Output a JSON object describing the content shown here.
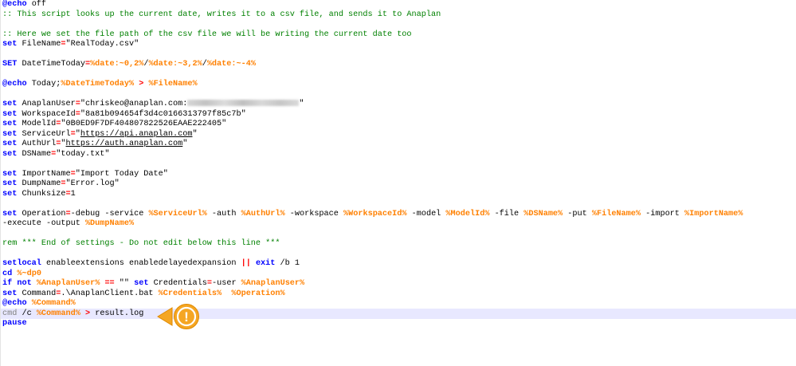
{
  "lines": [
    {
      "parts": [
        [
          "kw",
          "@echo"
        ],
        [
          "txt",
          " off"
        ]
      ]
    },
    {
      "parts": [
        [
          "cm",
          ":: This script looks up the current date, writes it to a csv file, and sends it to Anaplan"
        ]
      ]
    },
    {
      "parts": []
    },
    {
      "parts": [
        [
          "cm",
          ":: Here we set the file path of the csv file we will be writing the current date too"
        ]
      ]
    },
    {
      "parts": [
        [
          "kw",
          "set"
        ],
        [
          "txt",
          " FileName"
        ],
        [
          "op",
          "="
        ],
        [
          "txt",
          "\"RealToday.csv\""
        ]
      ]
    },
    {
      "parts": []
    },
    {
      "parts": [
        [
          "kw",
          "SET"
        ],
        [
          "txt",
          " DateTimeToday"
        ],
        [
          "op",
          "="
        ],
        [
          "vr",
          "%date:~0,2%"
        ],
        [
          "txt",
          "/"
        ],
        [
          "vr",
          "%date:~3,2%"
        ],
        [
          "txt",
          "/"
        ],
        [
          "vr",
          "%date:~-4%"
        ]
      ]
    },
    {
      "parts": []
    },
    {
      "parts": [
        [
          "kw",
          "@echo"
        ],
        [
          "txt",
          " Today;"
        ],
        [
          "vr",
          "%DateTimeToday%"
        ],
        [
          "txt",
          " "
        ],
        [
          "op",
          ">"
        ],
        [
          "txt",
          " "
        ],
        [
          "vr",
          "%FileName%"
        ]
      ]
    },
    {
      "parts": []
    },
    {
      "parts": [
        [
          "kw",
          "set"
        ],
        [
          "txt",
          " AnaplanUser"
        ],
        [
          "op",
          "="
        ],
        [
          "txt",
          "\"chriskeo@anaplan.com:"
        ],
        [
          "redact",
          ""
        ],
        [
          "txt",
          "\""
        ]
      ]
    },
    {
      "parts": [
        [
          "kw",
          "set"
        ],
        [
          "txt",
          " WorkspaceId"
        ],
        [
          "op",
          "="
        ],
        [
          "txt",
          "\"8a81b094654f3d4c0166313797f85c7b\""
        ]
      ]
    },
    {
      "parts": [
        [
          "kw",
          "set"
        ],
        [
          "txt",
          " ModelId"
        ],
        [
          "op",
          "="
        ],
        [
          "txt",
          "\"0B0ED9F7DF404807822526EAAE222405\""
        ]
      ]
    },
    {
      "parts": [
        [
          "kw",
          "set"
        ],
        [
          "txt",
          " ServiceUrl"
        ],
        [
          "op",
          "="
        ],
        [
          "txt",
          "\""
        ],
        [
          "ul",
          "https://api.anaplan.com"
        ],
        [
          "txt",
          "\""
        ]
      ]
    },
    {
      "parts": [
        [
          "kw",
          "set"
        ],
        [
          "txt",
          " AuthUrl"
        ],
        [
          "op",
          "="
        ],
        [
          "txt",
          "\""
        ],
        [
          "ul",
          "https://auth.anaplan.com"
        ],
        [
          "txt",
          "\""
        ]
      ]
    },
    {
      "parts": [
        [
          "kw",
          "set"
        ],
        [
          "txt",
          " DSName"
        ],
        [
          "op",
          "="
        ],
        [
          "txt",
          "\"today.txt\""
        ]
      ]
    },
    {
      "parts": []
    },
    {
      "parts": [
        [
          "kw",
          "set"
        ],
        [
          "txt",
          " ImportName"
        ],
        [
          "op",
          "="
        ],
        [
          "txt",
          "\"Import Today Date\""
        ]
      ]
    },
    {
      "parts": [
        [
          "kw",
          "set"
        ],
        [
          "txt",
          " DumpName"
        ],
        [
          "op",
          "="
        ],
        [
          "txt",
          "\"Error.log\""
        ]
      ]
    },
    {
      "parts": [
        [
          "kw",
          "set"
        ],
        [
          "txt",
          " Chunksize"
        ],
        [
          "op",
          "="
        ],
        [
          "txt",
          "1"
        ]
      ]
    },
    {
      "parts": []
    },
    {
      "parts": [
        [
          "kw",
          "set"
        ],
        [
          "txt",
          " Operation"
        ],
        [
          "op",
          "="
        ],
        [
          "txt",
          "-debug -service "
        ],
        [
          "vr",
          "%ServiceUrl%"
        ],
        [
          "txt",
          " -auth "
        ],
        [
          "vr",
          "%AuthUrl%"
        ],
        [
          "txt",
          " -workspace "
        ],
        [
          "vr",
          "%WorkspaceId%"
        ],
        [
          "txt",
          " -model "
        ],
        [
          "vr",
          "%ModelId%"
        ],
        [
          "txt",
          " -file "
        ],
        [
          "vr",
          "%DSName%"
        ],
        [
          "txt",
          " -put "
        ],
        [
          "vr",
          "%FileName%"
        ],
        [
          "txt",
          " -import "
        ],
        [
          "vr",
          "%ImportName%"
        ]
      ]
    },
    {
      "parts": [
        [
          "txt",
          "-execute -output "
        ],
        [
          "vr",
          "%DumpName%"
        ]
      ]
    },
    {
      "parts": []
    },
    {
      "parts": [
        [
          "cm",
          "rem *** End of settings - Do not edit below this line ***"
        ]
      ]
    },
    {
      "parts": []
    },
    {
      "parts": [
        [
          "kw",
          "setlocal"
        ],
        [
          "txt",
          " enableextensions enabledelayedexpansion "
        ],
        [
          "op",
          "||"
        ],
        [
          "txt",
          " "
        ],
        [
          "kw",
          "exit"
        ],
        [
          "txt",
          " /b 1"
        ]
      ]
    },
    {
      "parts": [
        [
          "kw",
          "cd"
        ],
        [
          "txt",
          " "
        ],
        [
          "vr",
          "%~dp0"
        ]
      ]
    },
    {
      "parts": [
        [
          "kw",
          "if"
        ],
        [
          "txt",
          " "
        ],
        [
          "kw",
          "not"
        ],
        [
          "txt",
          " "
        ],
        [
          "vr",
          "%AnaplanUser%"
        ],
        [
          "txt",
          " "
        ],
        [
          "op",
          "=="
        ],
        [
          "txt",
          " \"\" "
        ],
        [
          "kw",
          "set"
        ],
        [
          "txt",
          " Credentials"
        ],
        [
          "op",
          "="
        ],
        [
          "txt",
          "-user "
        ],
        [
          "vr",
          "%AnaplanUser%"
        ]
      ]
    },
    {
      "parts": [
        [
          "kw",
          "set"
        ],
        [
          "txt",
          " Command"
        ],
        [
          "op",
          "="
        ],
        [
          "txt",
          ".\\AnaplanClient.bat "
        ],
        [
          "vr",
          "%Credentials%"
        ],
        [
          "txt",
          "  "
        ],
        [
          "vr",
          "%Operation%"
        ]
      ]
    },
    {
      "parts": [
        [
          "kw",
          "@echo"
        ],
        [
          "txt",
          " "
        ],
        [
          "vr",
          "%Command%"
        ]
      ]
    },
    {
      "parts": [
        [
          "str",
          "cmd"
        ],
        [
          "txt",
          " /c "
        ],
        [
          "vr",
          "%Command%"
        ],
        [
          "txt",
          " "
        ],
        [
          "op",
          ">"
        ],
        [
          "txt",
          " result.log"
        ]
      ],
      "current": true
    },
    {
      "parts": [
        [
          "kw",
          "pause"
        ]
      ]
    }
  ],
  "callout": {
    "icon": "warning-exclamation-icon",
    "symbol": "!",
    "color": "#f5a623"
  }
}
